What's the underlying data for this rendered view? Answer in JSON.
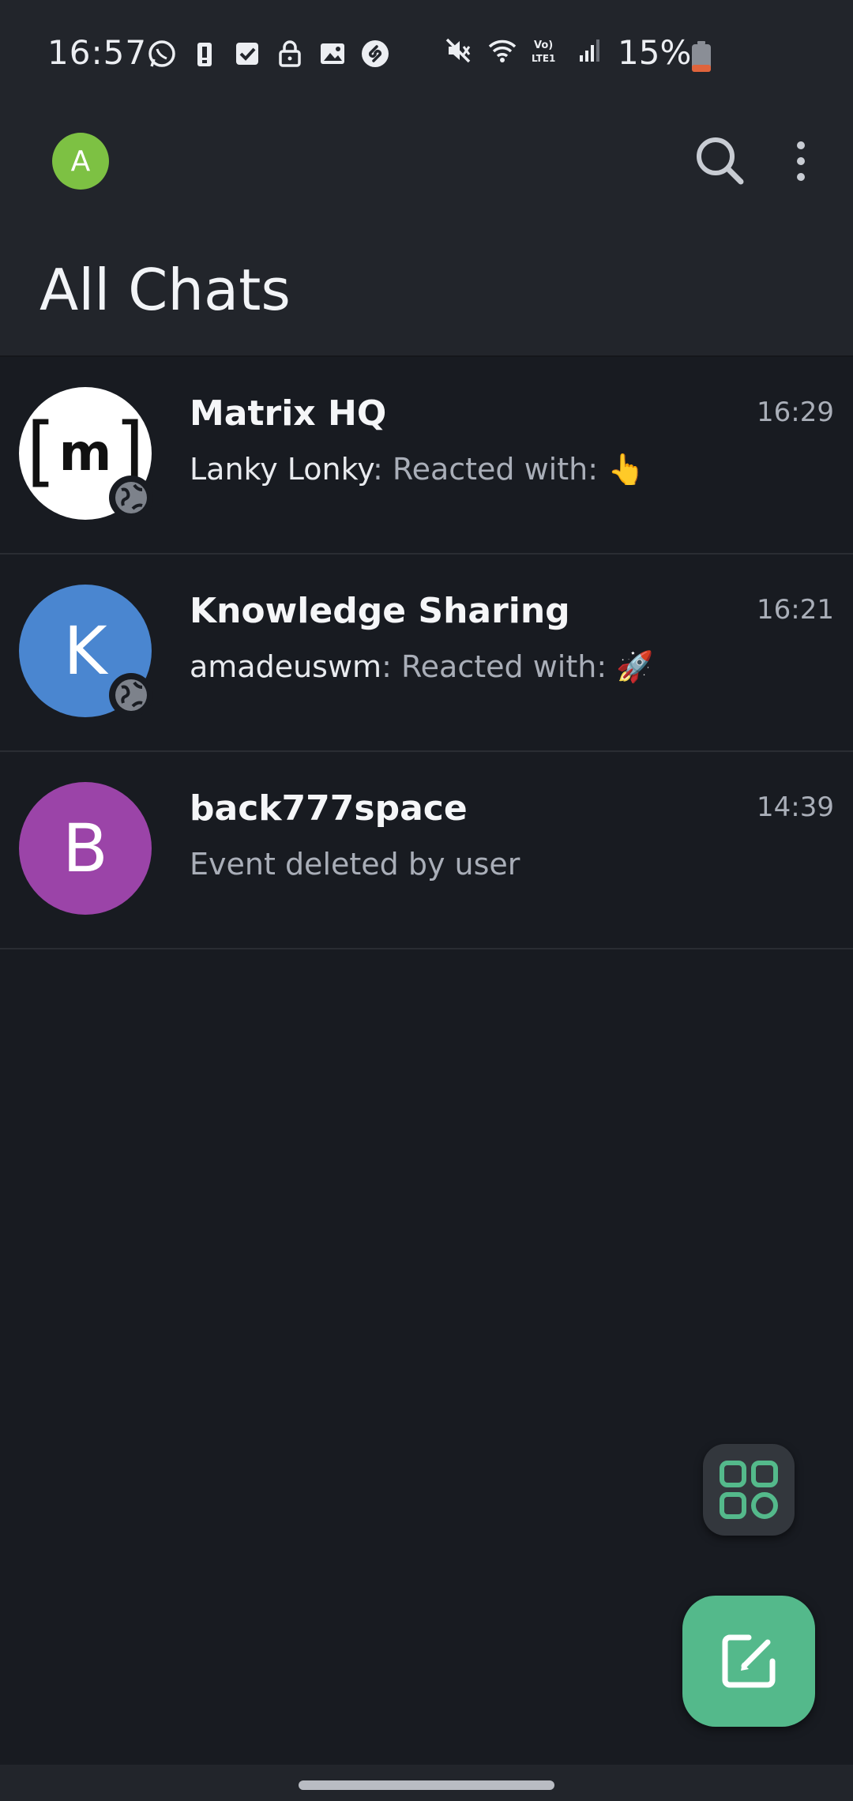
{
  "status_bar": {
    "time": "16:57",
    "battery": "15%",
    "battery_color": "#e0643c",
    "left_icons": [
      "whatsapp-icon",
      "battery-alert-icon",
      "checkbox-icon",
      "lock-icon",
      "image-icon",
      "shazam-icon"
    ],
    "right_icons": [
      "mute-icon",
      "wifi-icon",
      "volte-lte-icon",
      "signal-icon"
    ]
  },
  "header": {
    "account_initial": "A",
    "account_color": "#7dc143",
    "title": "All Chats"
  },
  "chats": [
    {
      "name": "Matrix HQ",
      "time": "16:29",
      "sender": "Lanky Lonky",
      "preview": ": Reacted with: 👆",
      "avatar": "matrix-logo",
      "public": true
    },
    {
      "name": "Knowledge Sharing",
      "time": "16:21",
      "sender": "amadeuswm",
      "preview": ": Reacted with: 🚀",
      "avatar_initial": "K",
      "avatar_color": "#4a86d0",
      "public": true
    },
    {
      "name": "back777space",
      "time": "14:39",
      "sender": "",
      "preview": "Event deleted by user",
      "avatar_initial": "B",
      "avatar_color": "#9b44a8",
      "public": false
    }
  ],
  "colors": {
    "background": "#181b21",
    "bar": "#22252b",
    "accent": "#54b98b"
  }
}
